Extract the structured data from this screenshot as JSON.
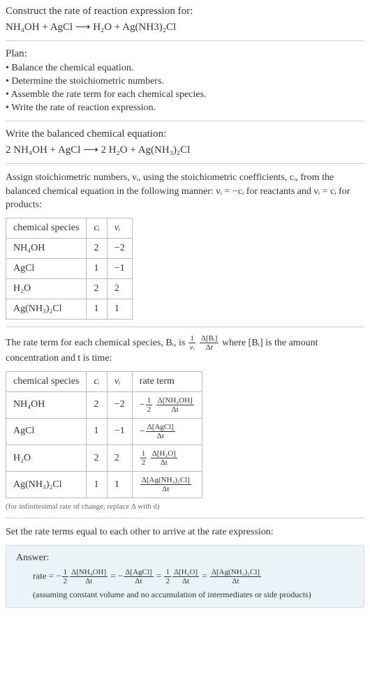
{
  "prompt": {
    "title": "Construct the rate of reaction expression for:",
    "equation": "NH₄OH + AgCl ⟶ H₂O + Ag(NH3)₂Cl"
  },
  "plan": {
    "title": "Plan:",
    "items": [
      "Balance the chemical equation.",
      "Determine the stoichiometric numbers.",
      "Assemble the rate term for each chemical species.",
      "Write the rate of reaction expression."
    ]
  },
  "balanced": {
    "title": "Write the balanced chemical equation:",
    "equation": "2 NH₄OH + AgCl ⟶ 2 H₂O + Ag(NH₃)₂Cl"
  },
  "stoich": {
    "text": "Assign stoichiometric numbers, νᵢ, using the stoichiometric coefficients, cᵢ, from the balanced chemical equation in the following manner: νᵢ = −cᵢ for reactants and νᵢ = cᵢ for products:",
    "headers": [
      "chemical species",
      "cᵢ",
      "νᵢ"
    ],
    "rows": [
      {
        "species": "NH₄OH",
        "c": "2",
        "v": "−2"
      },
      {
        "species": "AgCl",
        "c": "1",
        "v": "−1"
      },
      {
        "species": "H₂O",
        "c": "2",
        "v": "2"
      },
      {
        "species": "Ag(NH₃)₂Cl",
        "c": "1",
        "v": "1"
      }
    ]
  },
  "rateterm": {
    "text_before": "The rate term for each chemical species, Bᵢ, is ",
    "text_after": " where [Bᵢ] is the amount concentration and t is time:",
    "headers": [
      "chemical species",
      "cᵢ",
      "νᵢ",
      "rate term"
    ],
    "rows": [
      {
        "species": "NH₄OH",
        "c": "2",
        "v": "−2",
        "rate_prefix": "−",
        "rate_frac1_num": "1",
        "rate_frac1_den": "2",
        "rate_frac2_num": "Δ[NH₄OH]",
        "rate_frac2_den": "Δt"
      },
      {
        "species": "AgCl",
        "c": "1",
        "v": "−1",
        "rate_prefix": "−",
        "rate_frac1_num": "",
        "rate_frac1_den": "",
        "rate_frac2_num": "Δ[AgCl]",
        "rate_frac2_den": "Δt"
      },
      {
        "species": "H₂O",
        "c": "2",
        "v": "2",
        "rate_prefix": "",
        "rate_frac1_num": "1",
        "rate_frac1_den": "2",
        "rate_frac2_num": "Δ[H₂O]",
        "rate_frac2_den": "Δt"
      },
      {
        "species": "Ag(NH₃)₂Cl",
        "c": "1",
        "v": "1",
        "rate_prefix": "",
        "rate_frac1_num": "",
        "rate_frac1_den": "",
        "rate_frac2_num": "Δ[Ag(NH₃)₂Cl]",
        "rate_frac2_den": "Δt"
      }
    ],
    "note": "(for infinitesimal rate of change, replace Δ with d)"
  },
  "final": {
    "title": "Set the rate terms equal to each other to arrive at the rate expression:",
    "answer_label": "Answer:",
    "rate_label": "rate = ",
    "terms": [
      {
        "prefix": "−",
        "f1n": "1",
        "f1d": "2",
        "f2n": "Δ[NH₄OH]",
        "f2d": "Δt"
      },
      {
        "prefix": "−",
        "f1n": "",
        "f1d": "",
        "f2n": "Δ[AgCl]",
        "f2d": "Δt"
      },
      {
        "prefix": "",
        "f1n": "1",
        "f1d": "2",
        "f2n": "Δ[H₂O]",
        "f2d": "Δt"
      },
      {
        "prefix": "",
        "f1n": "",
        "f1d": "",
        "f2n": "Δ[Ag(NH₃)₂Cl]",
        "f2d": "Δt"
      }
    ],
    "note": "(assuming constant volume and no accumulation of intermediates or side products)"
  },
  "chart_data": {
    "type": "table",
    "tables": [
      {
        "title": "Stoichiometric numbers",
        "columns": [
          "chemical species",
          "c_i",
          "ν_i"
        ],
        "rows": [
          [
            "NH4OH",
            2,
            -2
          ],
          [
            "AgCl",
            1,
            -1
          ],
          [
            "H2O",
            2,
            2
          ],
          [
            "Ag(NH3)2Cl",
            1,
            1
          ]
        ]
      },
      {
        "title": "Rate terms",
        "columns": [
          "chemical species",
          "c_i",
          "ν_i",
          "rate term"
        ],
        "rows": [
          [
            "NH4OH",
            2,
            -2,
            "-(1/2) Δ[NH4OH]/Δt"
          ],
          [
            "AgCl",
            1,
            -1,
            "-Δ[AgCl]/Δt"
          ],
          [
            "H2O",
            2,
            2,
            "(1/2) Δ[H2O]/Δt"
          ],
          [
            "Ag(NH3)2Cl",
            1,
            1,
            "Δ[Ag(NH3)2Cl]/Δt"
          ]
        ]
      }
    ]
  }
}
